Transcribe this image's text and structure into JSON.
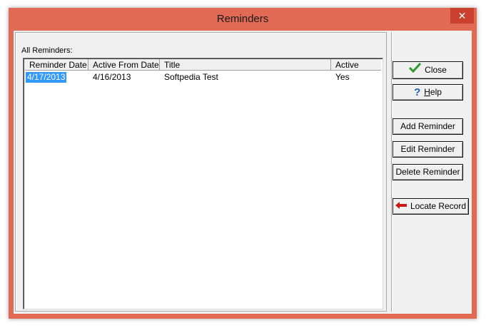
{
  "window": {
    "title": "Reminders",
    "close_glyph": "✕"
  },
  "list": {
    "label": "All Reminders:",
    "columns": [
      "Reminder Date",
      "Active From Date",
      "Title",
      "Active"
    ],
    "rows": [
      {
        "reminder_date": "4/17/2013",
        "active_from": "4/16/2013",
        "title": "Softpedia Test",
        "active": "Yes"
      }
    ]
  },
  "buttons": {
    "close": "Close",
    "help_mnemonic": "H",
    "help_rest": "elp",
    "add": "Add Reminder",
    "edit": "Edit Reminder",
    "delete": "Delete Reminder",
    "locate": "Locate Record"
  },
  "icons": {
    "close": "check-icon",
    "help": "question-mark-icon",
    "locate": "arrow-left-icon"
  },
  "colors": {
    "titlebar": "#e16a55",
    "close_button": "#c9412d",
    "selection": "#3399ff",
    "check": "#2e9a2e",
    "help": "#1a5fc8",
    "arrow": "#c81818"
  }
}
